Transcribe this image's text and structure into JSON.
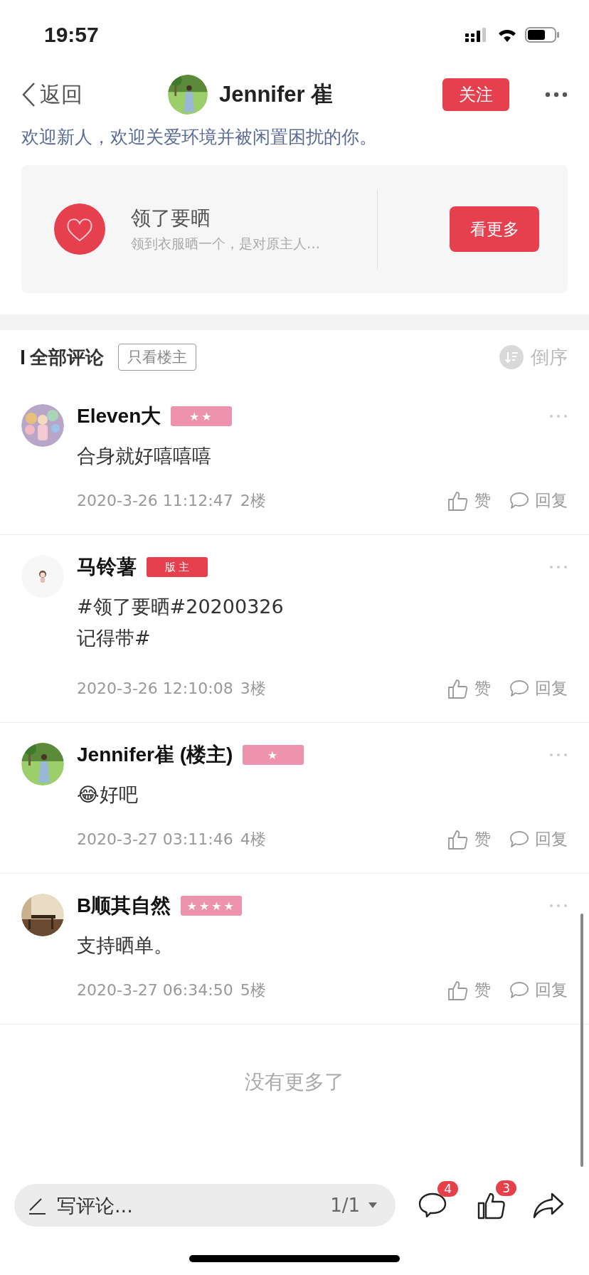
{
  "status_bar": {
    "time": "19:57"
  },
  "header": {
    "back": "返回",
    "title": "Jennifer 崔",
    "follow_button": "关注"
  },
  "intro": "欢迎新人，欢迎关爱环境并被闲置困扰的你。",
  "topic_card": {
    "title": "领了要晒",
    "subtitle": "领到衣服晒一个，是对原主人…",
    "button": "看更多"
  },
  "comments_header": {
    "title": "全部评论",
    "filter": "只看楼主",
    "sort": "倒序"
  },
  "comments": [
    {
      "name": "Eleven大",
      "badge": {
        "kind": "rank",
        "label": "★★"
      },
      "lines": [
        "合身就好嘻嘻嘻"
      ],
      "time": "2020-3-26 11:12:47",
      "floor": "2楼",
      "like": "赞",
      "reply": "回复"
    },
    {
      "name": "马铃薯",
      "badge": {
        "kind": "role",
        "label": "版 主"
      },
      "lines": [
        "#领了要晒#20200326",
        "记得带#"
      ],
      "time": "2020-3-26 12:10:08",
      "floor": "3楼",
      "like": "赞",
      "reply": "回复"
    },
    {
      "name": "Jennifer崔 (楼主)",
      "badge": {
        "kind": "rank",
        "label": "★"
      },
      "lines": [
        "😂好吧"
      ],
      "time": "2020-3-27 03:11:46",
      "floor": "4楼",
      "like": "赞",
      "reply": "回复"
    },
    {
      "name": "B顺其自然",
      "badge": {
        "kind": "rank",
        "label": "★★★★"
      },
      "lines": [
        "支持晒单。"
      ],
      "time": "2020-3-27 06:34:50",
      "floor": "5楼",
      "like": "赞",
      "reply": "回复"
    }
  ],
  "end_text": "没有更多了",
  "bottom_bar": {
    "placeholder": "写评论...",
    "page": "1/1",
    "comment_count": "4",
    "like_count": "3"
  }
}
